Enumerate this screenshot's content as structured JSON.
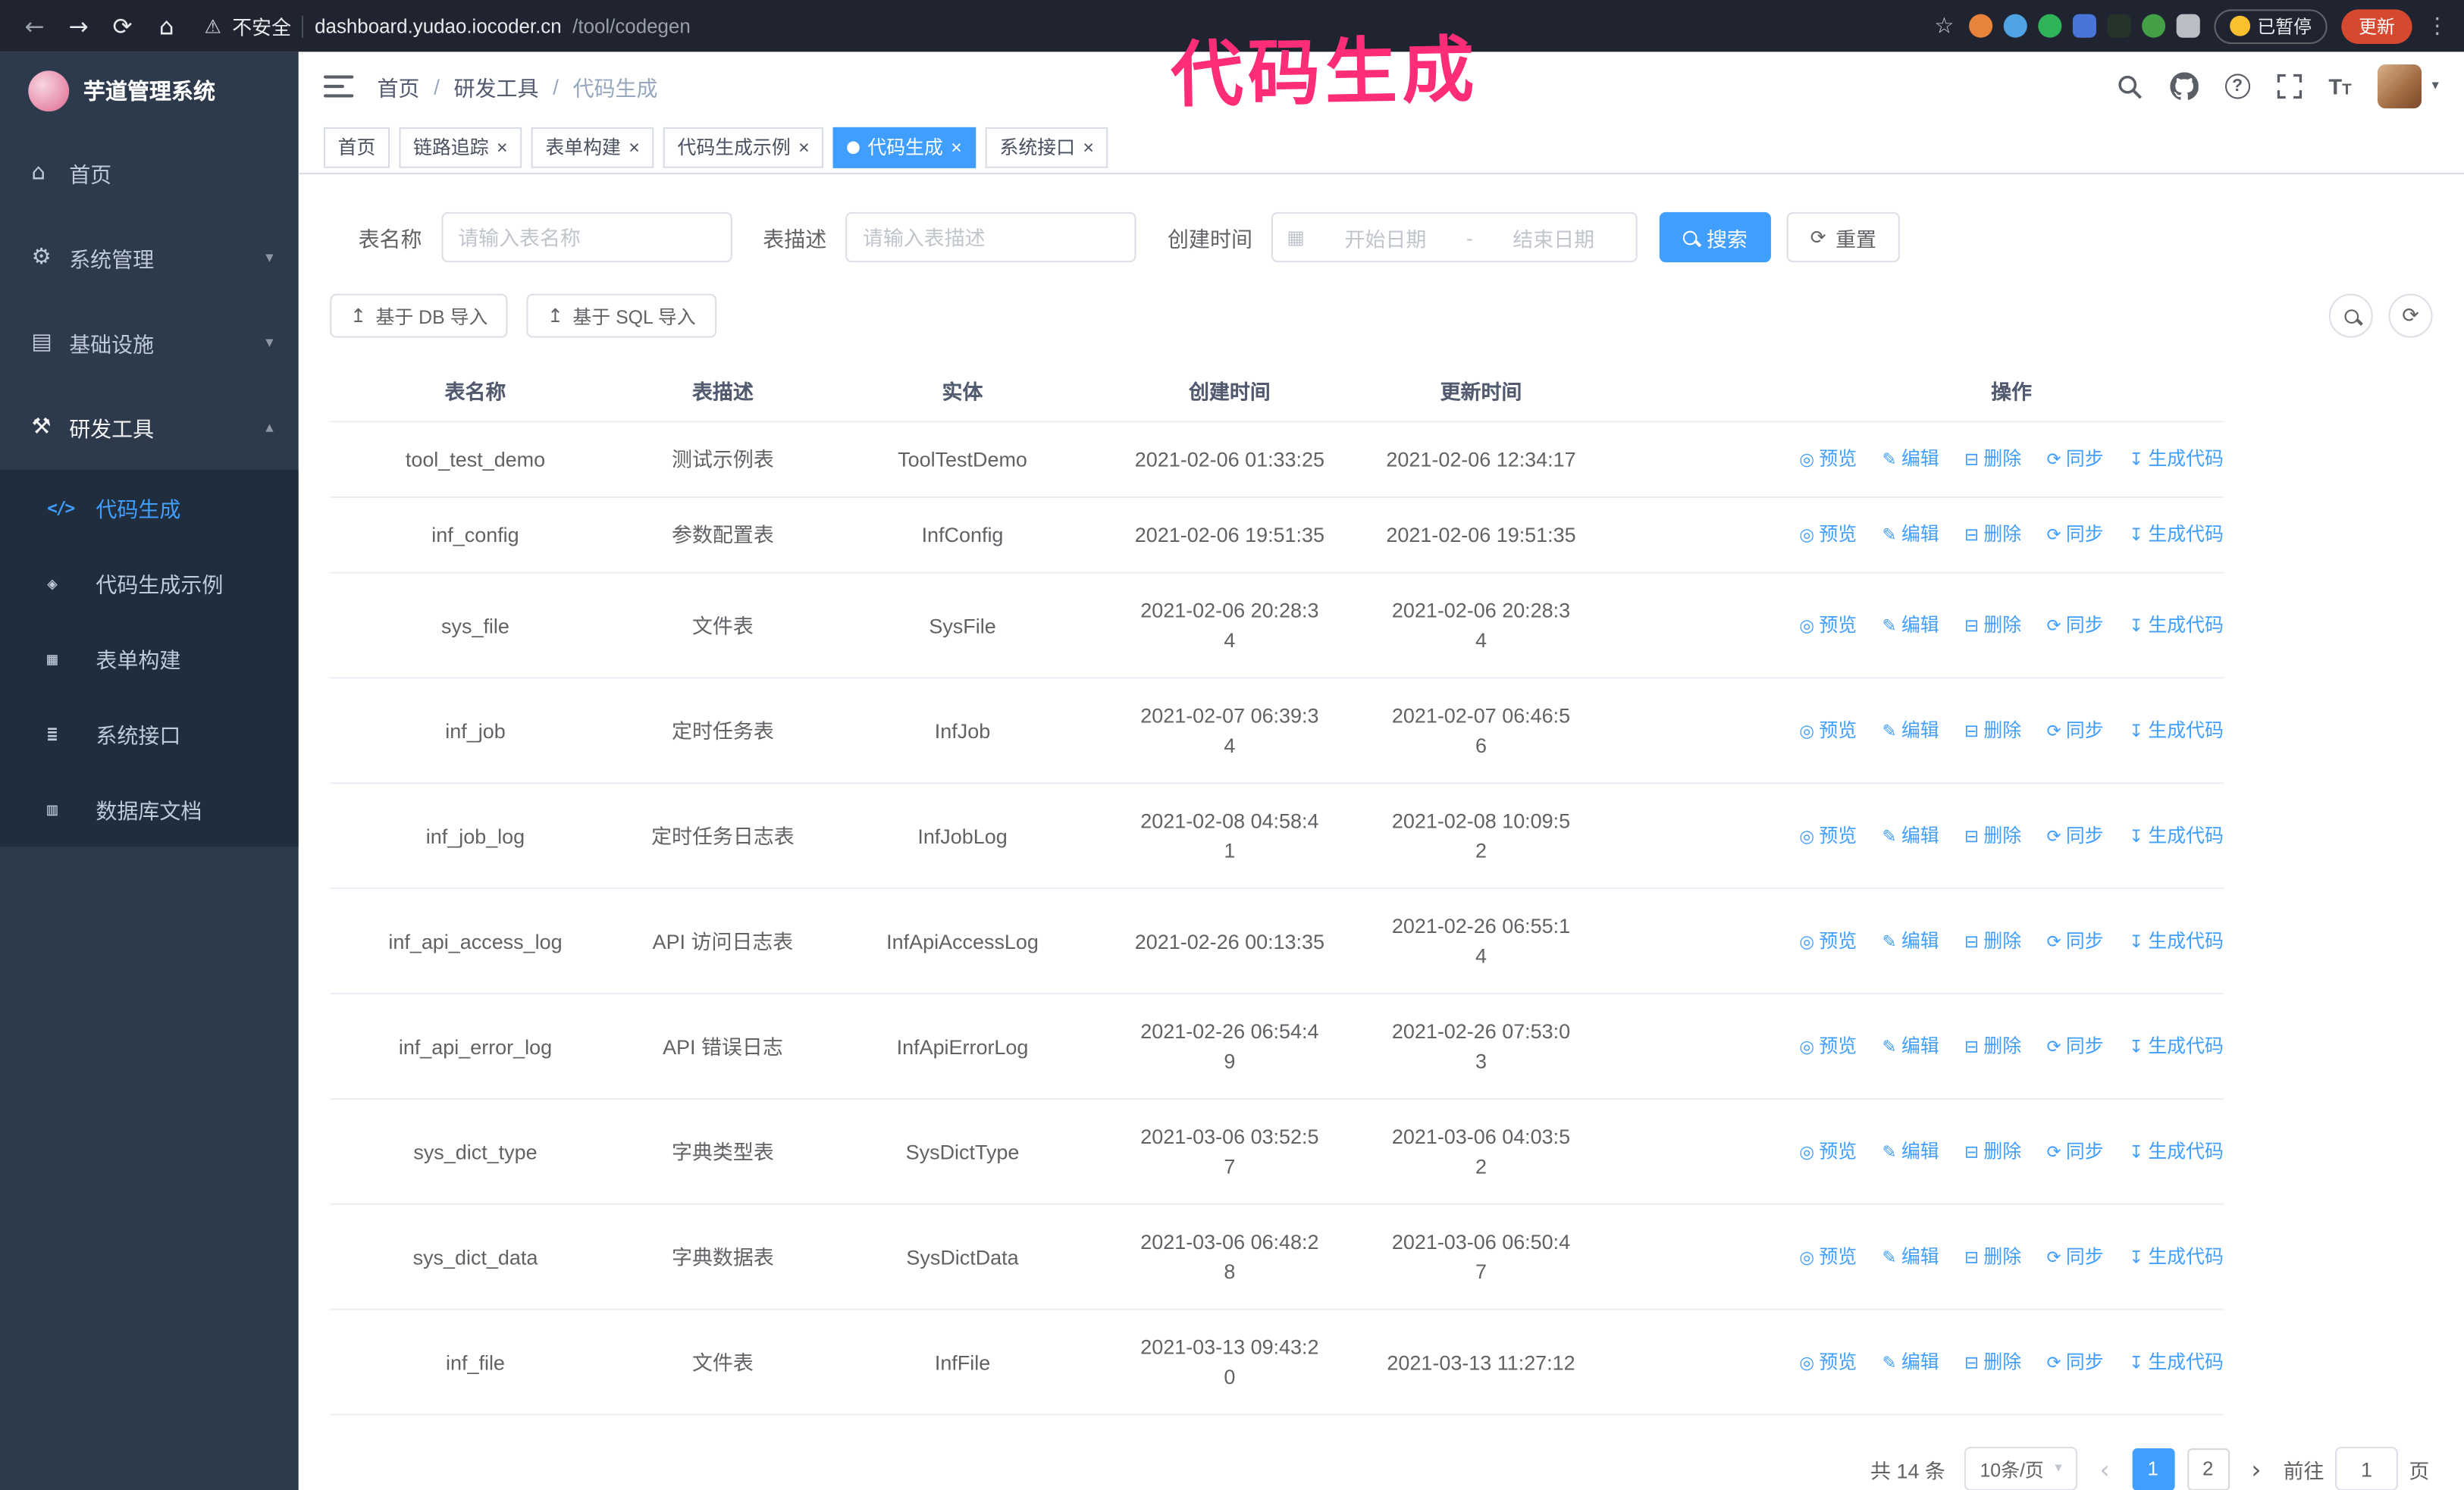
{
  "browser": {
    "security": "不安全",
    "url_host": "dashboard.yudao.iocoder.cn",
    "url_path": "/tool/codegen",
    "paused_badge": "已暂停",
    "update_button": "更新",
    "extensions": [
      {
        "name": "extension-icon",
        "color": "#e8833a",
        "round": true
      },
      {
        "name": "extension-icon",
        "color": "#4fa3e3",
        "round": true
      },
      {
        "name": "extension-icon",
        "color": "#2fb45a",
        "round": true
      },
      {
        "name": "extension-icon",
        "color": "#4a74d8",
        "round": false
      },
      {
        "name": "extension-icon",
        "color": "#25332a",
        "round": false
      },
      {
        "name": "extension-icon",
        "color": "#43a047",
        "round": true
      },
      {
        "name": "extension-icon",
        "color": "#b9bdc4",
        "round": false
      }
    ]
  },
  "annotation": "代码生成",
  "sidebar": {
    "title": "芋道管理系统",
    "items": [
      {
        "label": "首页",
        "icon": "home-icon"
      },
      {
        "label": "系统管理",
        "icon": "gear-icon",
        "expand": "down"
      },
      {
        "label": "基础设施",
        "icon": "infra-icon",
        "expand": "down"
      },
      {
        "label": "研发工具",
        "icon": "tools-icon",
        "expand": "up"
      }
    ],
    "sub_items": [
      {
        "label": "代码生成",
        "icon": "code-icon",
        "active": true
      },
      {
        "label": "代码生成示例",
        "icon": "example-icon",
        "active": false
      },
      {
        "label": "表单构建",
        "icon": "form-icon",
        "active": false
      },
      {
        "label": "系统接口",
        "icon": "api-icon",
        "active": false
      },
      {
        "label": "数据库文档",
        "icon": "db-icon",
        "active": false
      }
    ]
  },
  "header": {
    "breadcrumb": [
      "首页",
      "研发工具",
      "代码生成"
    ]
  },
  "tags": [
    {
      "label": "首页",
      "closable": false,
      "active": false
    },
    {
      "label": "链路追踪",
      "closable": true,
      "active": false
    },
    {
      "label": "表单构建",
      "closable": true,
      "active": false
    },
    {
      "label": "代码生成示例",
      "closable": true,
      "active": false
    },
    {
      "label": "代码生成",
      "closable": true,
      "active": true
    },
    {
      "label": "系统接口",
      "closable": true,
      "active": false
    }
  ],
  "filters": {
    "name_label": "表名称",
    "name_placeholder": "请输入表名称",
    "desc_label": "表描述",
    "desc_placeholder": "请输入表描述",
    "time_label": "创建时间",
    "start_placeholder": "开始日期",
    "range_separator": "-",
    "end_placeholder": "结束日期",
    "search_label": "搜索",
    "reset_label": "重置"
  },
  "toolbar": {
    "import_db_label": "基于 DB 导入",
    "import_sql_label": "基于 SQL 导入"
  },
  "table": {
    "headers": [
      "表名称",
      "表描述",
      "实体",
      "创建时间",
      "更新时间",
      "操作"
    ],
    "actions": [
      "预览",
      "编辑",
      "删除",
      "同步",
      "生成代码"
    ],
    "action_icons": [
      "eye-icon",
      "edit-icon",
      "delete-icon",
      "sync-icon",
      "generate-icon"
    ],
    "rows": [
      {
        "name": "tool_test_demo",
        "desc": "测试示例表",
        "entity": "ToolTestDemo",
        "created": "2021-02-06 01:33:25",
        "updated": "2021-02-06 12:34:17",
        "created_wrapped": false,
        "updated_wrapped": false
      },
      {
        "name": "inf_config",
        "desc": "参数配置表",
        "entity": "InfConfig",
        "created": "2021-02-06 19:51:35",
        "updated": "2021-02-06 19:51:35",
        "created_wrapped": false,
        "updated_wrapped": false
      },
      {
        "name": "sys_file",
        "desc": "文件表",
        "entity": "SysFile",
        "created": "2021-02-06 20:28:34",
        "updated": "2021-02-06 20:28:34",
        "created_wrapped": true,
        "updated_wrapped": true
      },
      {
        "name": "inf_job",
        "desc": "定时任务表",
        "entity": "InfJob",
        "created": "2021-02-07 06:39:34",
        "updated": "2021-02-07 06:46:56",
        "created_wrapped": true,
        "updated_wrapped": true
      },
      {
        "name": "inf_job_log",
        "desc": "定时任务日志表",
        "entity": "InfJobLog",
        "created": "2021-02-08 04:58:41",
        "updated": "2021-02-08 10:09:52",
        "created_wrapped": true,
        "updated_wrapped": true
      },
      {
        "name": "inf_api_access_log",
        "desc": "API 访问日志表",
        "entity": "InfApiAccessLog",
        "created": "2021-02-26 00:13:35",
        "updated": "2021-02-26 06:55:14",
        "created_wrapped": false,
        "updated_wrapped": true
      },
      {
        "name": "inf_api_error_log",
        "desc": "API 错误日志",
        "entity": "InfApiErrorLog",
        "created": "2021-02-26 06:54:49",
        "updated": "2021-02-26 07:53:03",
        "created_wrapped": true,
        "updated_wrapped": true
      },
      {
        "name": "sys_dict_type",
        "desc": "字典类型表",
        "entity": "SysDictType",
        "created": "2021-03-06 03:52:57",
        "updated": "2021-03-06 04:03:52",
        "created_wrapped": true,
        "updated_wrapped": true
      },
      {
        "name": "sys_dict_data",
        "desc": "字典数据表",
        "entity": "SysDictData",
        "created": "2021-03-06 06:48:28",
        "updated": "2021-03-06 06:50:47",
        "created_wrapped": true,
        "updated_wrapped": true
      },
      {
        "name": "inf_file",
        "desc": "文件表",
        "entity": "InfFile",
        "created": "2021-03-13 09:43:20",
        "updated": "2021-03-13 11:27:12",
        "created_wrapped": true,
        "updated_wrapped": false
      }
    ]
  },
  "pagination": {
    "total": "共 14 条",
    "page_size": "10条/页",
    "pages": [
      "1",
      "2"
    ],
    "active_page": "1",
    "goto_label": "前往",
    "goto_value": "1",
    "unit_label": "页"
  },
  "colors": {
    "accent": "#409eff",
    "annotation": "#ff2d78",
    "sidebar_bg": "#2d3a4b",
    "submenu_bg": "#1f2d3d",
    "update_button": "#d6492f"
  },
  "icon_glyphs": {
    "back-icon": "←",
    "forward-icon": "→",
    "reload-icon": "⟳",
    "chrome-home-icon": "⌂",
    "warning-icon": "⚠",
    "star-icon": "☆",
    "kebab-icon": "⋮",
    "home-icon": "⌂",
    "gear-icon": "⚙",
    "infra-icon": "▤",
    "tools-icon": "⚒",
    "code-icon": "</>",
    "example-icon": "◈",
    "form-icon": "▦",
    "api-icon": "≣",
    "db-icon": "▥",
    "eye-icon": "◎",
    "edit-icon": "✎",
    "delete-icon": "⊟",
    "sync-icon": "⟳",
    "generate-icon": "↧",
    "upload-icon": "↥",
    "refresh-icon": "⟳",
    "calendar-icon": "▦",
    "caret-down": "▾",
    "caret-up": "▴",
    "close-icon": "×",
    "chevron-left": "‹",
    "chevron-right": "›"
  }
}
